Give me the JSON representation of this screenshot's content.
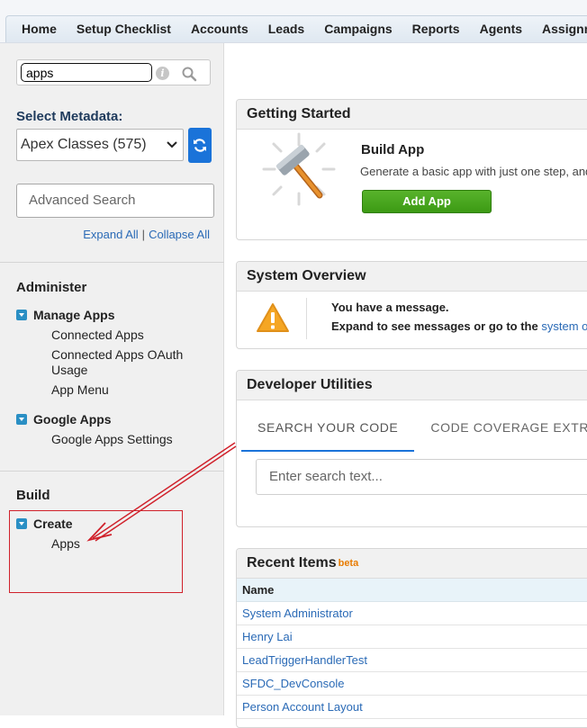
{
  "nav": {
    "tabs": [
      "Home",
      "Setup Checklist",
      "Accounts",
      "Leads",
      "Campaigns",
      "Reports",
      "Agents",
      "Assignments"
    ]
  },
  "sidebar": {
    "quick_find_value": "apps",
    "select_metadata_label": "Select Metadata:",
    "metadata_selected": "Apex Classes (575)",
    "advanced_search_placeholder": "Advanced Search",
    "expand_all": "Expand All",
    "collapse_all": "Collapse All",
    "separator": "|",
    "sections": [
      {
        "title": "Administer",
        "groups": [
          {
            "label": "Manage Apps",
            "items": [
              "Connected Apps",
              "Connected Apps OAuth Usage",
              "App Menu"
            ]
          },
          {
            "label": "Google Apps",
            "items": [
              "Google Apps Settings"
            ]
          }
        ]
      },
      {
        "title": "Build",
        "groups": [
          {
            "label": "Create",
            "items": [
              "Apps"
            ]
          }
        ]
      }
    ]
  },
  "getting_started": {
    "title": "Getting Started",
    "build_app_title": "Build App",
    "build_app_desc": "Generate a basic app with just one step, and",
    "add_app_button": "Add App"
  },
  "system_overview": {
    "title": "System Overview",
    "message_line1": "You have a message.",
    "message_line2": "Expand to see messages or go to the",
    "message_link": "system o"
  },
  "developer_utilities": {
    "title": "Developer Utilities",
    "tabs": [
      "SEARCH YOUR CODE",
      "CODE COVERAGE EXTRA"
    ],
    "search_placeholder": "Enter search text..."
  },
  "recent_items": {
    "title": "Recent Items",
    "badge": "beta",
    "column_header": "Name",
    "rows": [
      "System Administrator",
      "Henry Lai",
      "LeadTriggerHandlerTest",
      "SFDC_DevConsole",
      "Person Account Layout"
    ]
  },
  "colors": {
    "brand_blue": "#1a73d9",
    "link_blue": "#2a6ab6",
    "add_button_green": "#3c9a14",
    "annotation_red": "#d0212b"
  }
}
